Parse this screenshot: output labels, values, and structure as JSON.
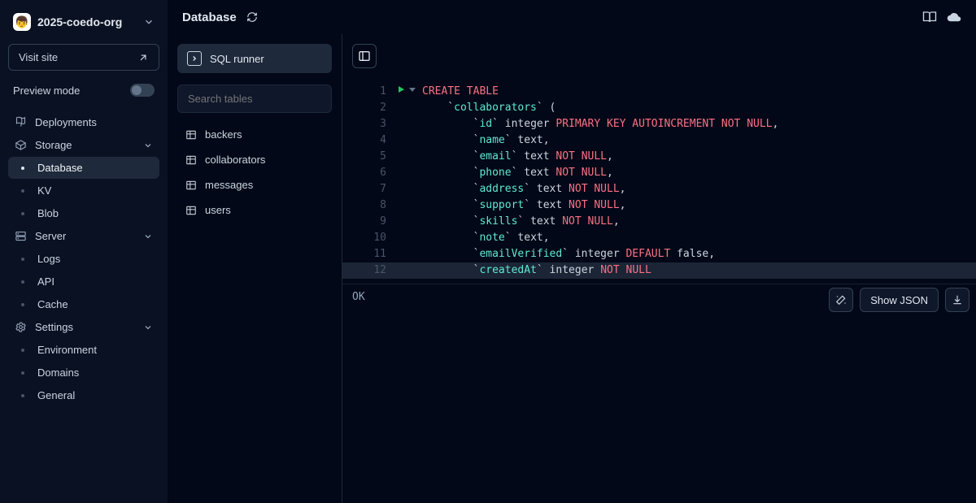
{
  "project": {
    "name": "2025-coedo-org",
    "avatar_emoji": "👦"
  },
  "sidebar": {
    "visit_label": "Visit site",
    "preview_label": "Preview mode",
    "items": [
      {
        "label": "Deployments",
        "icon": "rocket",
        "children": []
      },
      {
        "label": "Storage",
        "icon": "box",
        "expandable": true,
        "children": [
          {
            "label": "Database",
            "active": true
          },
          {
            "label": "KV"
          },
          {
            "label": "Blob"
          }
        ]
      },
      {
        "label": "Server",
        "icon": "server",
        "expandable": true,
        "children": [
          {
            "label": "Logs"
          },
          {
            "label": "API"
          },
          {
            "label": "Cache"
          }
        ]
      },
      {
        "label": "Settings",
        "icon": "gear",
        "expandable": true,
        "children": [
          {
            "label": "Environment"
          },
          {
            "label": "Domains"
          },
          {
            "label": "General"
          }
        ]
      }
    ]
  },
  "header": {
    "title": "Database"
  },
  "tables": {
    "sql_runner_label": "SQL runner",
    "search_placeholder": "Search tables",
    "list": [
      "backers",
      "collaborators",
      "messages",
      "users"
    ]
  },
  "editor": {
    "lines": [
      [
        {
          "t": "CREATE TABLE",
          "c": "kw"
        }
      ],
      [
        {
          "t": "    `",
          "c": "type"
        },
        {
          "t": "collaborators",
          "c": "str"
        },
        {
          "t": "` (",
          "c": "type"
        }
      ],
      [
        {
          "t": "        `",
          "c": "type"
        },
        {
          "t": "id",
          "c": "str"
        },
        {
          "t": "` integer ",
          "c": "type"
        },
        {
          "t": "PRIMARY KEY AUTOINCREMENT NOT NULL",
          "c": "kw"
        },
        {
          "t": ",",
          "c": "type"
        }
      ],
      [
        {
          "t": "        `",
          "c": "type"
        },
        {
          "t": "name",
          "c": "str"
        },
        {
          "t": "` text,",
          "c": "type"
        }
      ],
      [
        {
          "t": "        `",
          "c": "type"
        },
        {
          "t": "email",
          "c": "str"
        },
        {
          "t": "` text ",
          "c": "type"
        },
        {
          "t": "NOT NULL",
          "c": "kw"
        },
        {
          "t": ",",
          "c": "type"
        }
      ],
      [
        {
          "t": "        `",
          "c": "type"
        },
        {
          "t": "phone",
          "c": "str"
        },
        {
          "t": "` text ",
          "c": "type"
        },
        {
          "t": "NOT NULL",
          "c": "kw"
        },
        {
          "t": ",",
          "c": "type"
        }
      ],
      [
        {
          "t": "        `",
          "c": "type"
        },
        {
          "t": "address",
          "c": "str"
        },
        {
          "t": "` text ",
          "c": "type"
        },
        {
          "t": "NOT NULL",
          "c": "kw"
        },
        {
          "t": ",",
          "c": "type"
        }
      ],
      [
        {
          "t": "        `",
          "c": "type"
        },
        {
          "t": "support",
          "c": "str"
        },
        {
          "t": "` text ",
          "c": "type"
        },
        {
          "t": "NOT NULL",
          "c": "kw"
        },
        {
          "t": ",",
          "c": "type"
        }
      ],
      [
        {
          "t": "        `",
          "c": "type"
        },
        {
          "t": "skills",
          "c": "str"
        },
        {
          "t": "` text ",
          "c": "type"
        },
        {
          "t": "NOT NULL",
          "c": "kw"
        },
        {
          "t": ",",
          "c": "type"
        }
      ],
      [
        {
          "t": "        `",
          "c": "type"
        },
        {
          "t": "note",
          "c": "str"
        },
        {
          "t": "` text,",
          "c": "type"
        }
      ],
      [
        {
          "t": "        `",
          "c": "type"
        },
        {
          "t": "emailVerified",
          "c": "str"
        },
        {
          "t": "` integer ",
          "c": "type"
        },
        {
          "t": "DEFAULT",
          "c": "kw"
        },
        {
          "t": " false,",
          "c": "type"
        }
      ],
      [
        {
          "t": "        `",
          "c": "type"
        },
        {
          "t": "createdAt",
          "c": "str"
        },
        {
          "t": "` integer ",
          "c": "type"
        },
        {
          "t": "NOT NULL",
          "c": "kw"
        }
      ]
    ],
    "result": "OK",
    "show_json_label": "Show JSON"
  }
}
